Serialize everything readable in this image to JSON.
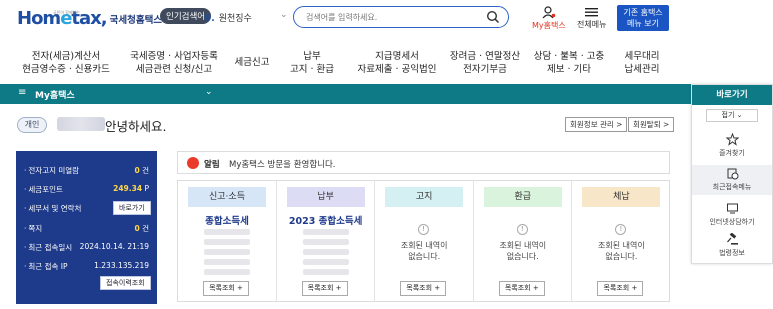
{
  "header": {
    "logo_text": "Hometax",
    "logo_sub": "국세청홈택스",
    "logo_tagline": "국민이 함께하는",
    "popular_badge": "인기검색어",
    "popular_num": "9.",
    "popular_term": "원천징수",
    "search_placeholder": "검색어를 입력하세요.",
    "my_label": "My홈택스",
    "menu_label": "전체메뉴",
    "old_btn_line1": "기존 홈택스",
    "old_btn_line2": "메뉴 보기"
  },
  "gnb": [
    {
      "line1": "전자(세금)계산서",
      "line2": "현금영수증 · 신용카드"
    },
    {
      "line1": "국세증명 · 사업자등록",
      "line2": "세금관련 신청/신고"
    },
    {
      "line1": "세금신고",
      "line2": ""
    },
    {
      "line1": "납부",
      "line2": "고지 · 환급"
    },
    {
      "line1": "지급명세서",
      "line2": "자료제출 · 공익법인"
    },
    {
      "line1": "장려금 · 연말정산",
      "line2": "전자기부금"
    },
    {
      "line1": "상담 · 불복 · 고충",
      "line2": "제보 · 기타"
    },
    {
      "line1": "세무대리",
      "line2": "납세관리"
    }
  ],
  "mybar": {
    "label": "My홈택스",
    "hamburger": "≡",
    "chevron": "⌄"
  },
  "greeting": {
    "badge": "개인",
    "text": "안녕하세요.",
    "member_info_btn": "회원정보 관리 >",
    "withdraw_btn": "회원탈퇴 >"
  },
  "left_panel": {
    "rows": [
      {
        "key": "전자고지 미열람",
        "value": "0",
        "unit": " 건"
      },
      {
        "key": "세금포인트",
        "value": "249.34",
        "unit": " P"
      },
      {
        "key": "세무서 및 연락처",
        "value": "",
        "unit": ""
      },
      {
        "key": "쪽지",
        "value": "0",
        "unit": " 건"
      },
      {
        "key": "최근 접속일시",
        "value": "2024.10.14.  21:19",
        "unit": ""
      },
      {
        "key": "최근 접속 IP",
        "value": "1.233.135.219",
        "unit": ""
      }
    ],
    "shortcut_btn": "바로가기",
    "history_btn": "접속이력조회"
  },
  "notice": {
    "label": "알림",
    "text": "My홈택스 방문을 환영합니다."
  },
  "cards": [
    {
      "header": "신고·소득",
      "title": "종합소득세",
      "color": "#d7e6f7",
      "empty": "",
      "detail": "목록조회 +"
    },
    {
      "header": "납부",
      "title": "2023 종합소득세",
      "color": "#dcdcf5",
      "empty": "",
      "detail": "목록조회 +"
    },
    {
      "header": "고지",
      "title": "",
      "color": "#d5f0f2",
      "empty": "조회된 내역이\n없습니다.",
      "detail": "목록조회 +"
    },
    {
      "header": "환급",
      "title": "",
      "color": "#d9f3dd",
      "empty": "조회된 내역이\n없습니다.",
      "detail": "목록조회 +"
    },
    {
      "header": "체납",
      "title": "",
      "color": "#f8e6c8",
      "empty": "조회된 내역이\n없습니다.",
      "detail": "목록조회 +"
    }
  ],
  "quick": {
    "title": "바로가기",
    "fold": "접기 ⌄",
    "items": [
      "즐겨찾기",
      "최근접속메뉴",
      "인터넷상담하기",
      "법령정보"
    ]
  }
}
